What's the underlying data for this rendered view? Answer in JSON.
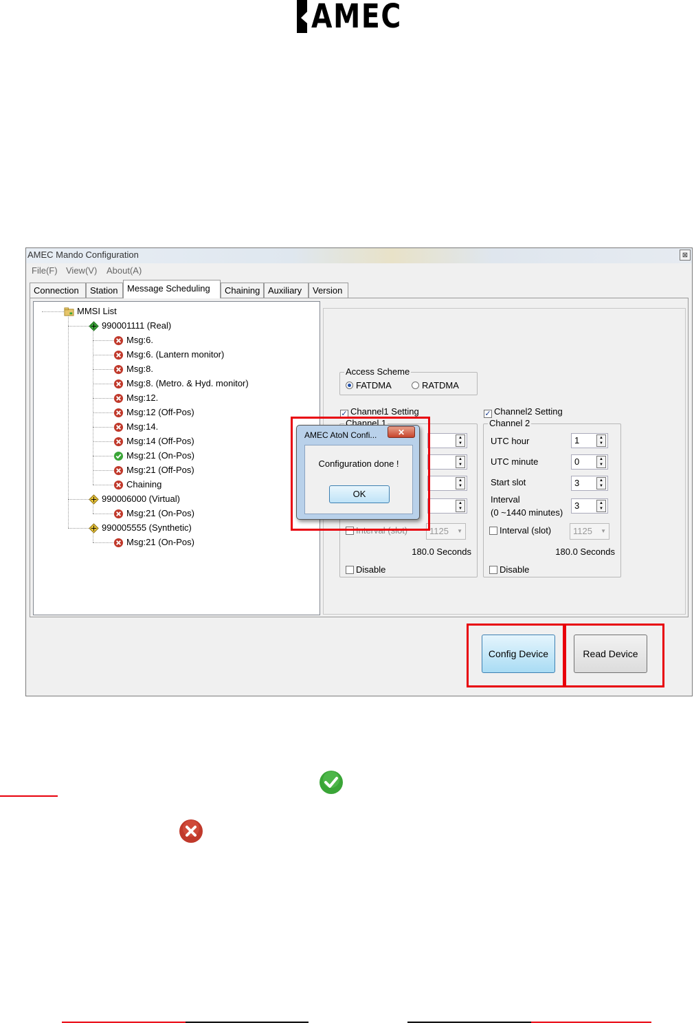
{
  "logo": {
    "text": "AMEC"
  },
  "window": {
    "title": "AMEC Mando Configuration",
    "close_glyph": "⊠",
    "menu": [
      "File(F)",
      "View(V)",
      "About(A)"
    ],
    "tabs": [
      "Connection",
      "Station",
      "Message Scheduling",
      "Chaining",
      "Auxiliary",
      "Version"
    ],
    "active_tab": "Message Scheduling"
  },
  "tree": {
    "root": "MMSI List",
    "items": [
      {
        "label": "990001111  (Real)",
        "level": 1,
        "icon": "green-diamond-icon"
      },
      {
        "label": "Msg:6.",
        "level": 2,
        "icon": "red-x-icon"
      },
      {
        "label": "Msg:6. (Lantern monitor)",
        "level": 2,
        "icon": "red-x-icon"
      },
      {
        "label": "Msg:8.",
        "level": 2,
        "icon": "red-x-icon"
      },
      {
        "label": "Msg:8. (Metro. & Hyd. monitor)",
        "level": 2,
        "icon": "red-x-icon"
      },
      {
        "label": "Msg:12.",
        "level": 2,
        "icon": "red-x-icon"
      },
      {
        "label": "Msg:12  (Off-Pos)",
        "level": 2,
        "icon": "red-x-icon"
      },
      {
        "label": "Msg:14.",
        "level": 2,
        "icon": "red-x-icon"
      },
      {
        "label": "Msg:14  (Off-Pos)",
        "level": 2,
        "icon": "red-x-icon"
      },
      {
        "label": "Msg:21  (On-Pos)",
        "level": 2,
        "icon": "green-check-icon"
      },
      {
        "label": "Msg:21  (Off-Pos)",
        "level": 2,
        "icon": "red-x-icon"
      },
      {
        "label": "Chaining",
        "level": 2,
        "icon": "red-x-icon"
      },
      {
        "label": "990006000  (Virtual)",
        "level": 1,
        "icon": "yellow-diamond-icon"
      },
      {
        "label": "Msg:21  (On-Pos)",
        "level": 2,
        "icon": "red-x-icon"
      },
      {
        "label": "990005555  (Synthetic)",
        "level": 1,
        "icon": "yellow-diamond-icon"
      },
      {
        "label": "Msg:21  (On-Pos)",
        "level": 2,
        "icon": "red-x-icon"
      }
    ]
  },
  "access_scheme": {
    "title": "Access Scheme",
    "options": [
      "FATDMA",
      "RATDMA"
    ],
    "selected": "FATDMA"
  },
  "channel1": {
    "checkbox_label": "Channel1 Setting",
    "checked": true,
    "group_title": "Channel 1",
    "interval_slot_label": "Interval (slot)",
    "interval_slot_value": "1125",
    "seconds": "180.0 Seconds",
    "disable_label": "Disable"
  },
  "channel2": {
    "checkbox_label": "Channel2 Setting",
    "checked": true,
    "group_title": "Channel 2",
    "utc_hour_label": "UTC hour",
    "utc_hour_value": "1",
    "utc_minute_label": "UTC minute",
    "utc_minute_value": "0",
    "start_slot_label": "Start slot",
    "start_slot_value": "3",
    "interval_label": "Interval",
    "interval_range": "(0 ~1440 minutes)",
    "interval_value": "3",
    "interval_slot_label": "Interval (slot)",
    "interval_slot_value": "1125",
    "seconds": "180.0 Seconds",
    "disable_label": "Disable"
  },
  "buttons": {
    "config": "Config Device",
    "read": "Read Device"
  },
  "dialog": {
    "title": "AMEC AtoN Confi...",
    "close_glyph": "✕",
    "message": "Configuration done !",
    "ok": "OK"
  },
  "colors": {
    "highlight": "#e8000b",
    "success": "#3aa537",
    "error": "#c0392b"
  }
}
